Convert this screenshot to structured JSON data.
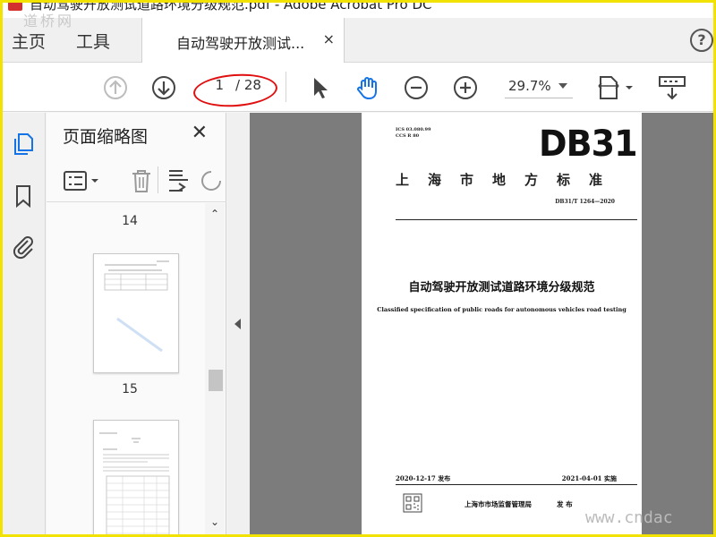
{
  "window": {
    "title": "自动驾驶开放测试道路环境分级规范.pdf - Adobe Acrobat Pro DC"
  },
  "watermarks": {
    "top_left": "道桥网",
    "bottom_right": "www.cndac"
  },
  "tabs": {
    "home": "主页",
    "tools": "工具",
    "document": "自动驾驶开放测试...",
    "close": "×",
    "help": "?"
  },
  "toolbar": {
    "page_current": "1",
    "page_total": "/ 28",
    "zoom": "29.7%"
  },
  "thumbnails_panel": {
    "title": "页面缩略图",
    "close": "✕",
    "pages": [
      "14",
      "15"
    ]
  },
  "document": {
    "ics": "ICS 03.080.99",
    "ccs": "CCS R 80",
    "logo": "DB31",
    "local_standard": "上海市地方标准",
    "standard_no": "DB31/T 1264—2020",
    "title_cn": "自动驾驶开放测试道路环境分级规范",
    "title_en": "Classified specification of public roads for autonomous vehicles road testing",
    "issue_date": "2020-12-17 发布",
    "impl_date": "2021-04-01 实施",
    "publisher": "上海市市场监督管理局",
    "publish": "发  布"
  },
  "colors": {
    "annotation_ellipse": "#e01010",
    "frame": "#f2e200",
    "accent_blue": "#1473e6"
  }
}
